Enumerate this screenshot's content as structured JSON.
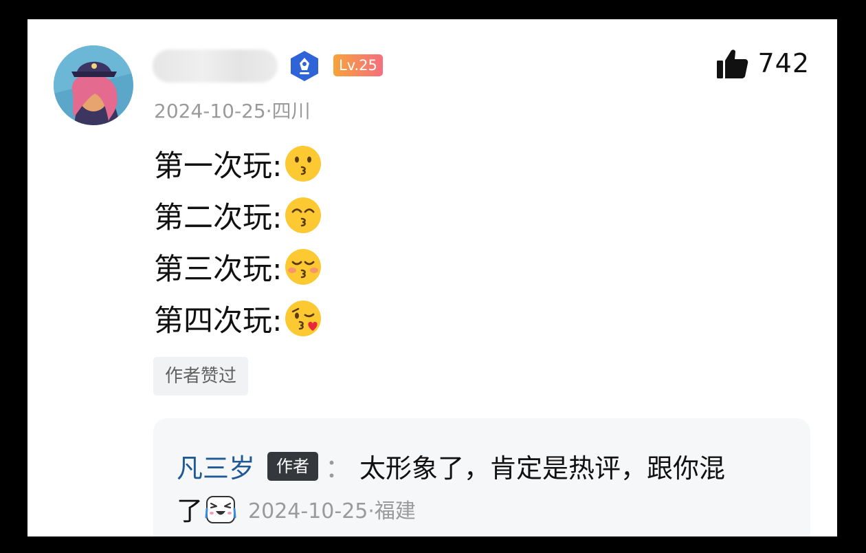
{
  "user": {
    "level": "Lv.25",
    "date": "2024-10-25",
    "location": "四川",
    "separator": "·"
  },
  "likes": {
    "count": "742",
    "icon": "thumbs-up-icon"
  },
  "comment": {
    "lines": [
      {
        "text": "第一次玩:",
        "emoji": "kissing-face"
      },
      {
        "text": "第二次玩:",
        "emoji": "kissing-face-smiling-eyes"
      },
      {
        "text": "第三次玩:",
        "emoji": "kissing-face-closed-eyes"
      },
      {
        "text": "第四次玩:",
        "emoji": "face-blowing-kiss"
      }
    ],
    "author_liked": "作者赞过"
  },
  "reply": {
    "name": "凡三岁",
    "tag": "作者",
    "colon": "：",
    "text_line1": "太形象了，肯定是热评，跟你混",
    "text_line2": "了",
    "date": "2024-10-25",
    "separator": "·",
    "location": "福建"
  },
  "colors": {
    "reply_name": "#1f5a96",
    "level_badge_start": "#f7a23a",
    "level_badge_end": "#f46f7e",
    "shield_badge": "#2f63d8"
  }
}
